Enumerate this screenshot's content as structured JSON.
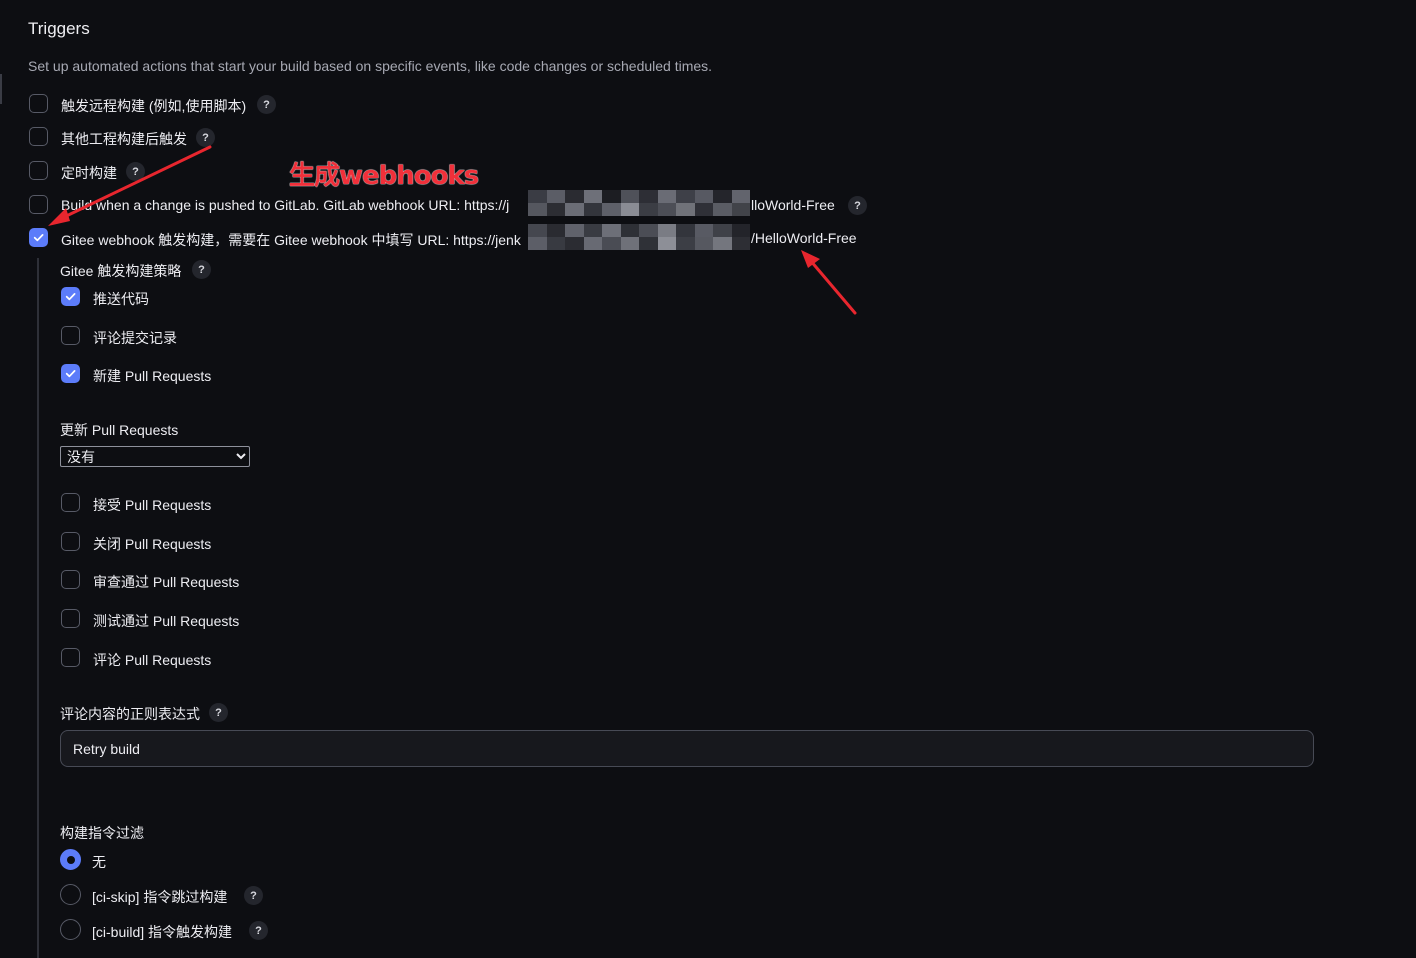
{
  "section": {
    "title": "Triggers",
    "description": "Set up automated actions that start your build based on specific events, like code changes or scheduled times."
  },
  "triggers": [
    {
      "label": "触发远程构建 (例如,使用脚本)",
      "checked": false,
      "help": true
    },
    {
      "label": "其他工程构建后触发",
      "checked": false,
      "help": true
    },
    {
      "label": "定时构建",
      "checked": false,
      "help": true
    },
    {
      "label_prefix": "Build when a change is pushed to GitLab. GitLab webhook URL: https://j",
      "label_suffix": "lloWorld-Free",
      "checked": false,
      "help": true
    },
    {
      "label_prefix": "Gitee webhook 触发构建，需要在 Gitee webhook 中填写 URL: https://jenk",
      "label_suffix": "/HelloWorld-Free",
      "checked": true,
      "help": false
    }
  ],
  "help_glyph": "?",
  "gitee": {
    "strategy_label": "Gitee 触发构建策略",
    "strategies": [
      {
        "label": "推送代码",
        "checked": true
      },
      {
        "label": "评论提交记录",
        "checked": false
      },
      {
        "label": "新建 Pull Requests",
        "checked": true
      }
    ],
    "update_pr_label": "更新 Pull Requests",
    "update_pr_value": "没有",
    "pr_actions": [
      {
        "label": "接受 Pull Requests",
        "checked": false
      },
      {
        "label": "关闭 Pull Requests",
        "checked": false
      },
      {
        "label": "审查通过 Pull Requests",
        "checked": false
      },
      {
        "label": "测试通过 Pull Requests",
        "checked": false
      },
      {
        "label": "评论 Pull Requests",
        "checked": false
      }
    ],
    "regex_label": "评论内容的正则表达式",
    "regex_value": "Retry build",
    "filter_label": "构建指令过滤",
    "filters": [
      {
        "label": "无",
        "selected": true,
        "help": false
      },
      {
        "label": "[ci-skip] 指令跳过构建",
        "selected": false,
        "help": true
      },
      {
        "label": "[ci-build] 指令触发构建",
        "selected": false,
        "help": true
      }
    ]
  },
  "annotation": {
    "text": "生成webhooks",
    "color": "#f0303a"
  },
  "colors": {
    "accent": "#5c7cfa",
    "background": "#0d0e12"
  }
}
